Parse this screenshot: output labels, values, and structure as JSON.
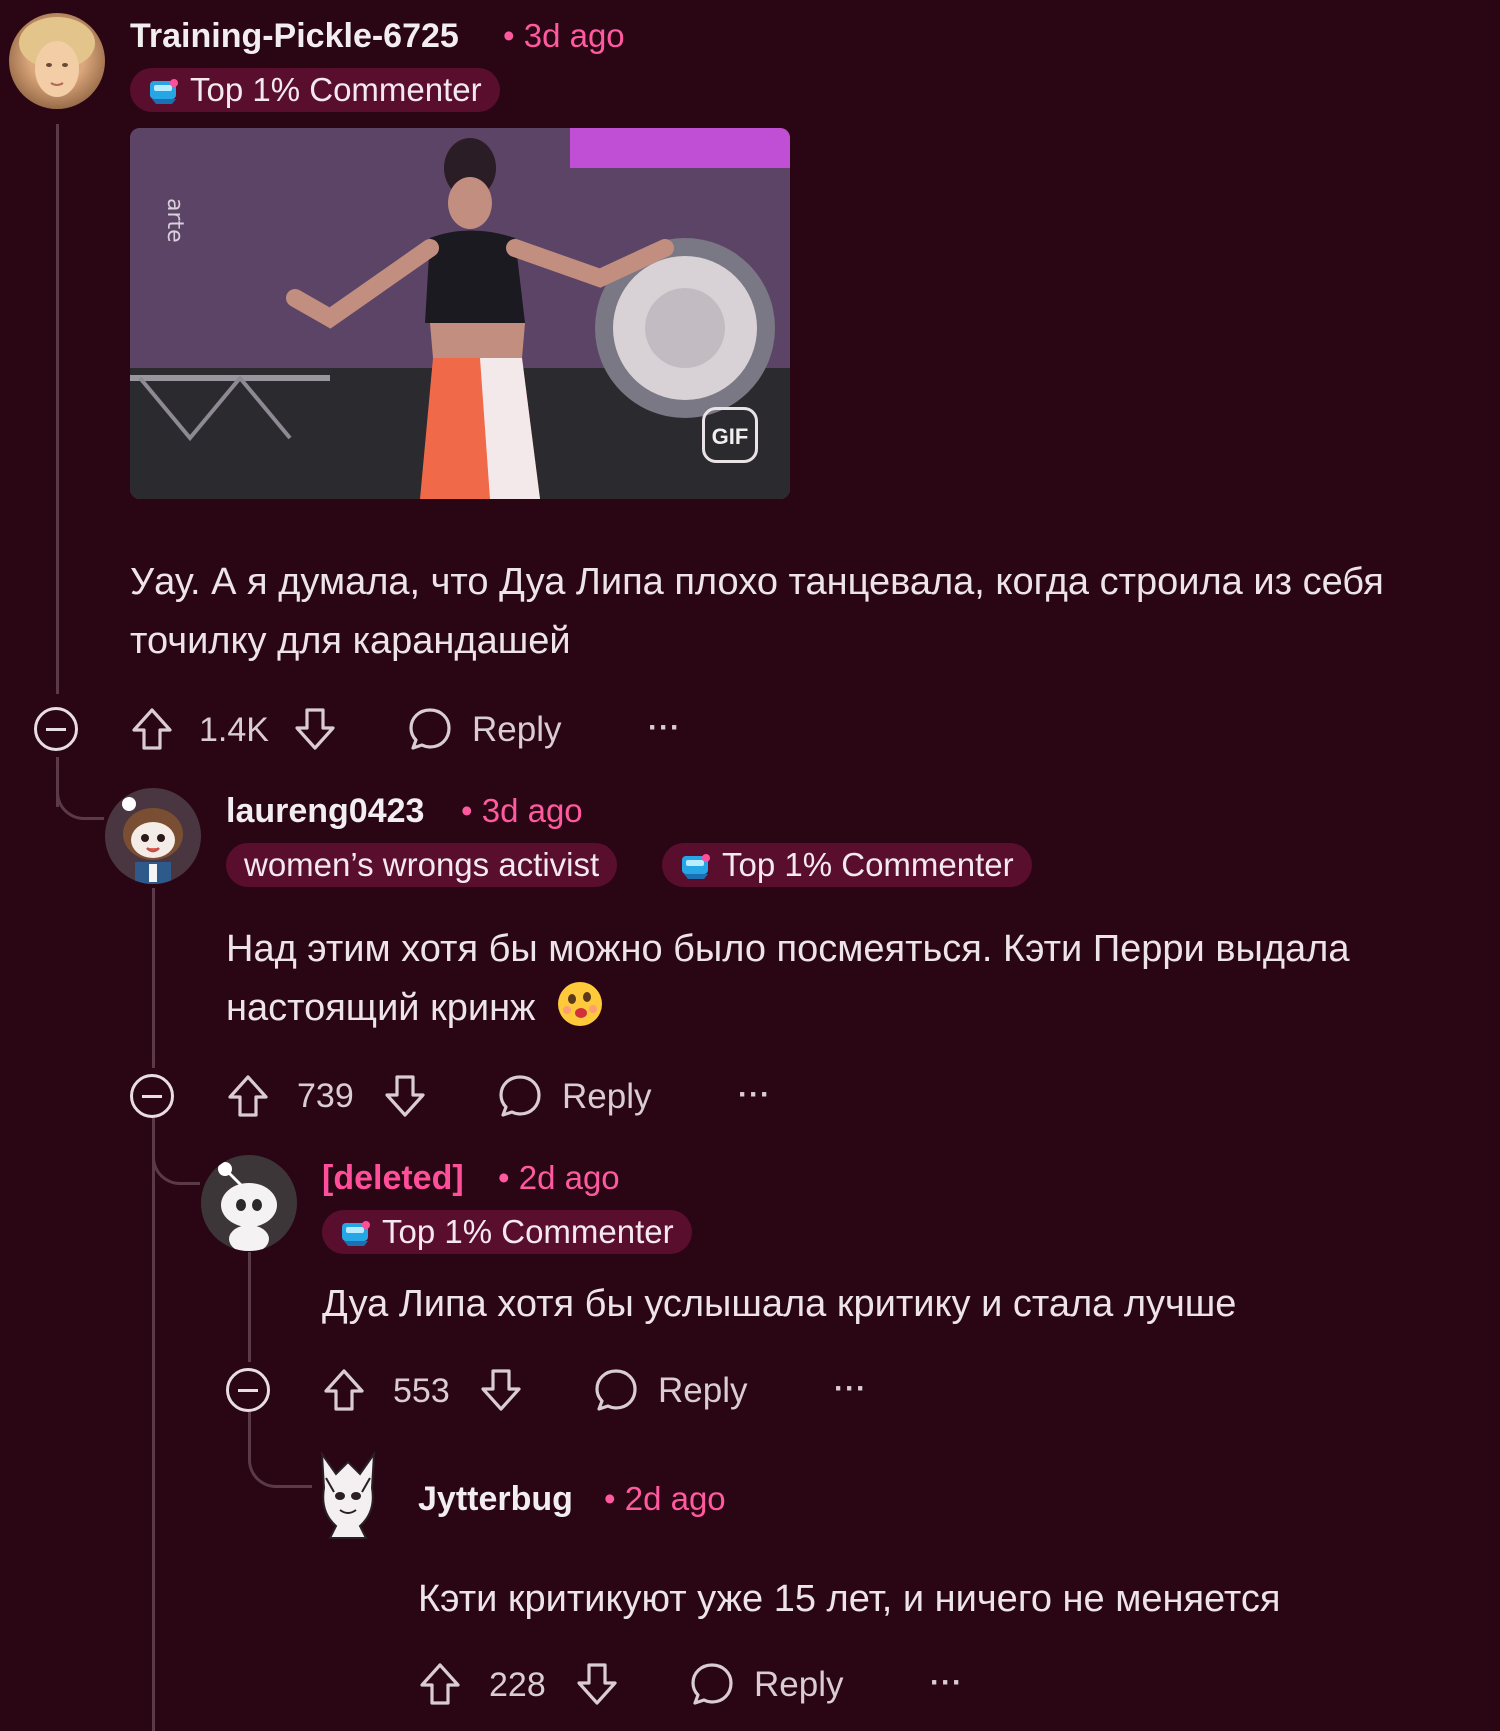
{
  "comments": [
    {
      "username": "Training-Pickle-6725",
      "time": "• 3d ago",
      "flairs": [
        "Top 1% Commenter"
      ],
      "media": {
        "badge": "GIF"
      },
      "body": "Уау. А я думала, что Дуа Липа плохо танцевала, когда строила из себя точилку для карандашей",
      "score": "1.4K",
      "reply_label": "Reply",
      "more": "···"
    },
    {
      "username": "laureng0423",
      "time": "• 3d ago",
      "flairs": [
        "women’s wrongs activist",
        "Top 1% Commenter"
      ],
      "body": "Над этим хотя бы можно было посмеяться. Кэти Перри выдала настоящий кринж",
      "emoji": "🫨",
      "score": "739",
      "reply_label": "Reply",
      "more": "···"
    },
    {
      "username": "[deleted]",
      "time": "• 2d ago",
      "flairs": [
        "Top 1% Commenter"
      ],
      "body": "Дуа Липа хотя бы услышала критику и стала лучше",
      "score": "553",
      "reply_label": "Reply",
      "more": "···"
    },
    {
      "username": "Jytterbug",
      "time": "• 2d ago",
      "flairs": [],
      "body": "Кэти критикуют уже 15 лет, и ничего не меняется",
      "score": "228",
      "reply_label": "Reply",
      "more": "···"
    }
  ],
  "icons": {
    "upvote": "upvote-icon",
    "downvote": "downvote-icon",
    "reply": "comment-bubble-icon",
    "collapse": "collapse-thread-icon",
    "flair": "top-commenter-icon"
  },
  "colors": {
    "background": "#2a0513",
    "accent": "#ff5aa0",
    "flair_bg": "#5a0e2e",
    "thread_line": "#5a3a49"
  }
}
